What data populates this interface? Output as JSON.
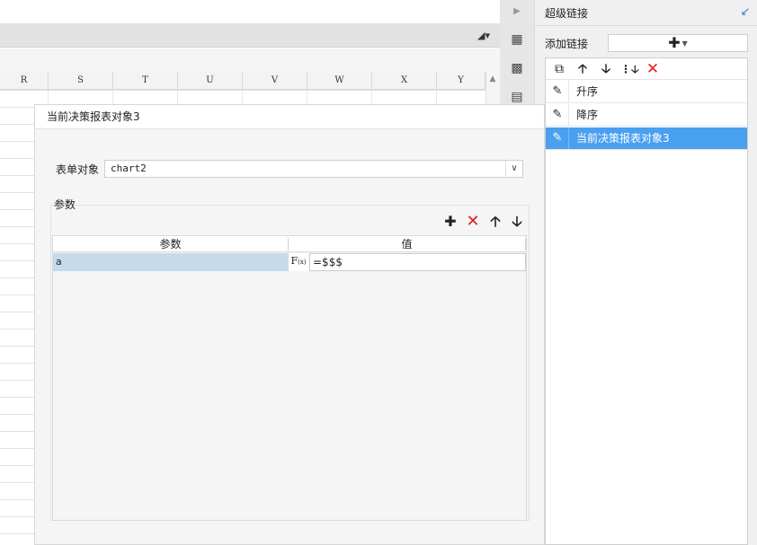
{
  "sheet": {
    "columns": [
      "R",
      "S",
      "T",
      "U",
      "V",
      "W",
      "X",
      "Y"
    ]
  },
  "right_panel": {
    "title": "超级链接",
    "add_label": "添加链接",
    "add_button_icon": "plus-icon",
    "items": [
      {
        "label": "升序",
        "selected": false
      },
      {
        "label": "降序",
        "selected": false
      },
      {
        "label": "当前决策报表对象3",
        "selected": true
      }
    ],
    "selected_color": "#4aa0f0"
  },
  "dialog": {
    "title": "当前决策报表对象3",
    "form_object_label": "表单对象",
    "form_object_value": "chart2",
    "params_section_label": "参数",
    "table": {
      "headers": [
        "参数",
        "值"
      ],
      "rows": [
        {
          "name": "a",
          "value": "=$$$"
        }
      ]
    },
    "fx_label": "F",
    "fx_sub": "(x)"
  }
}
